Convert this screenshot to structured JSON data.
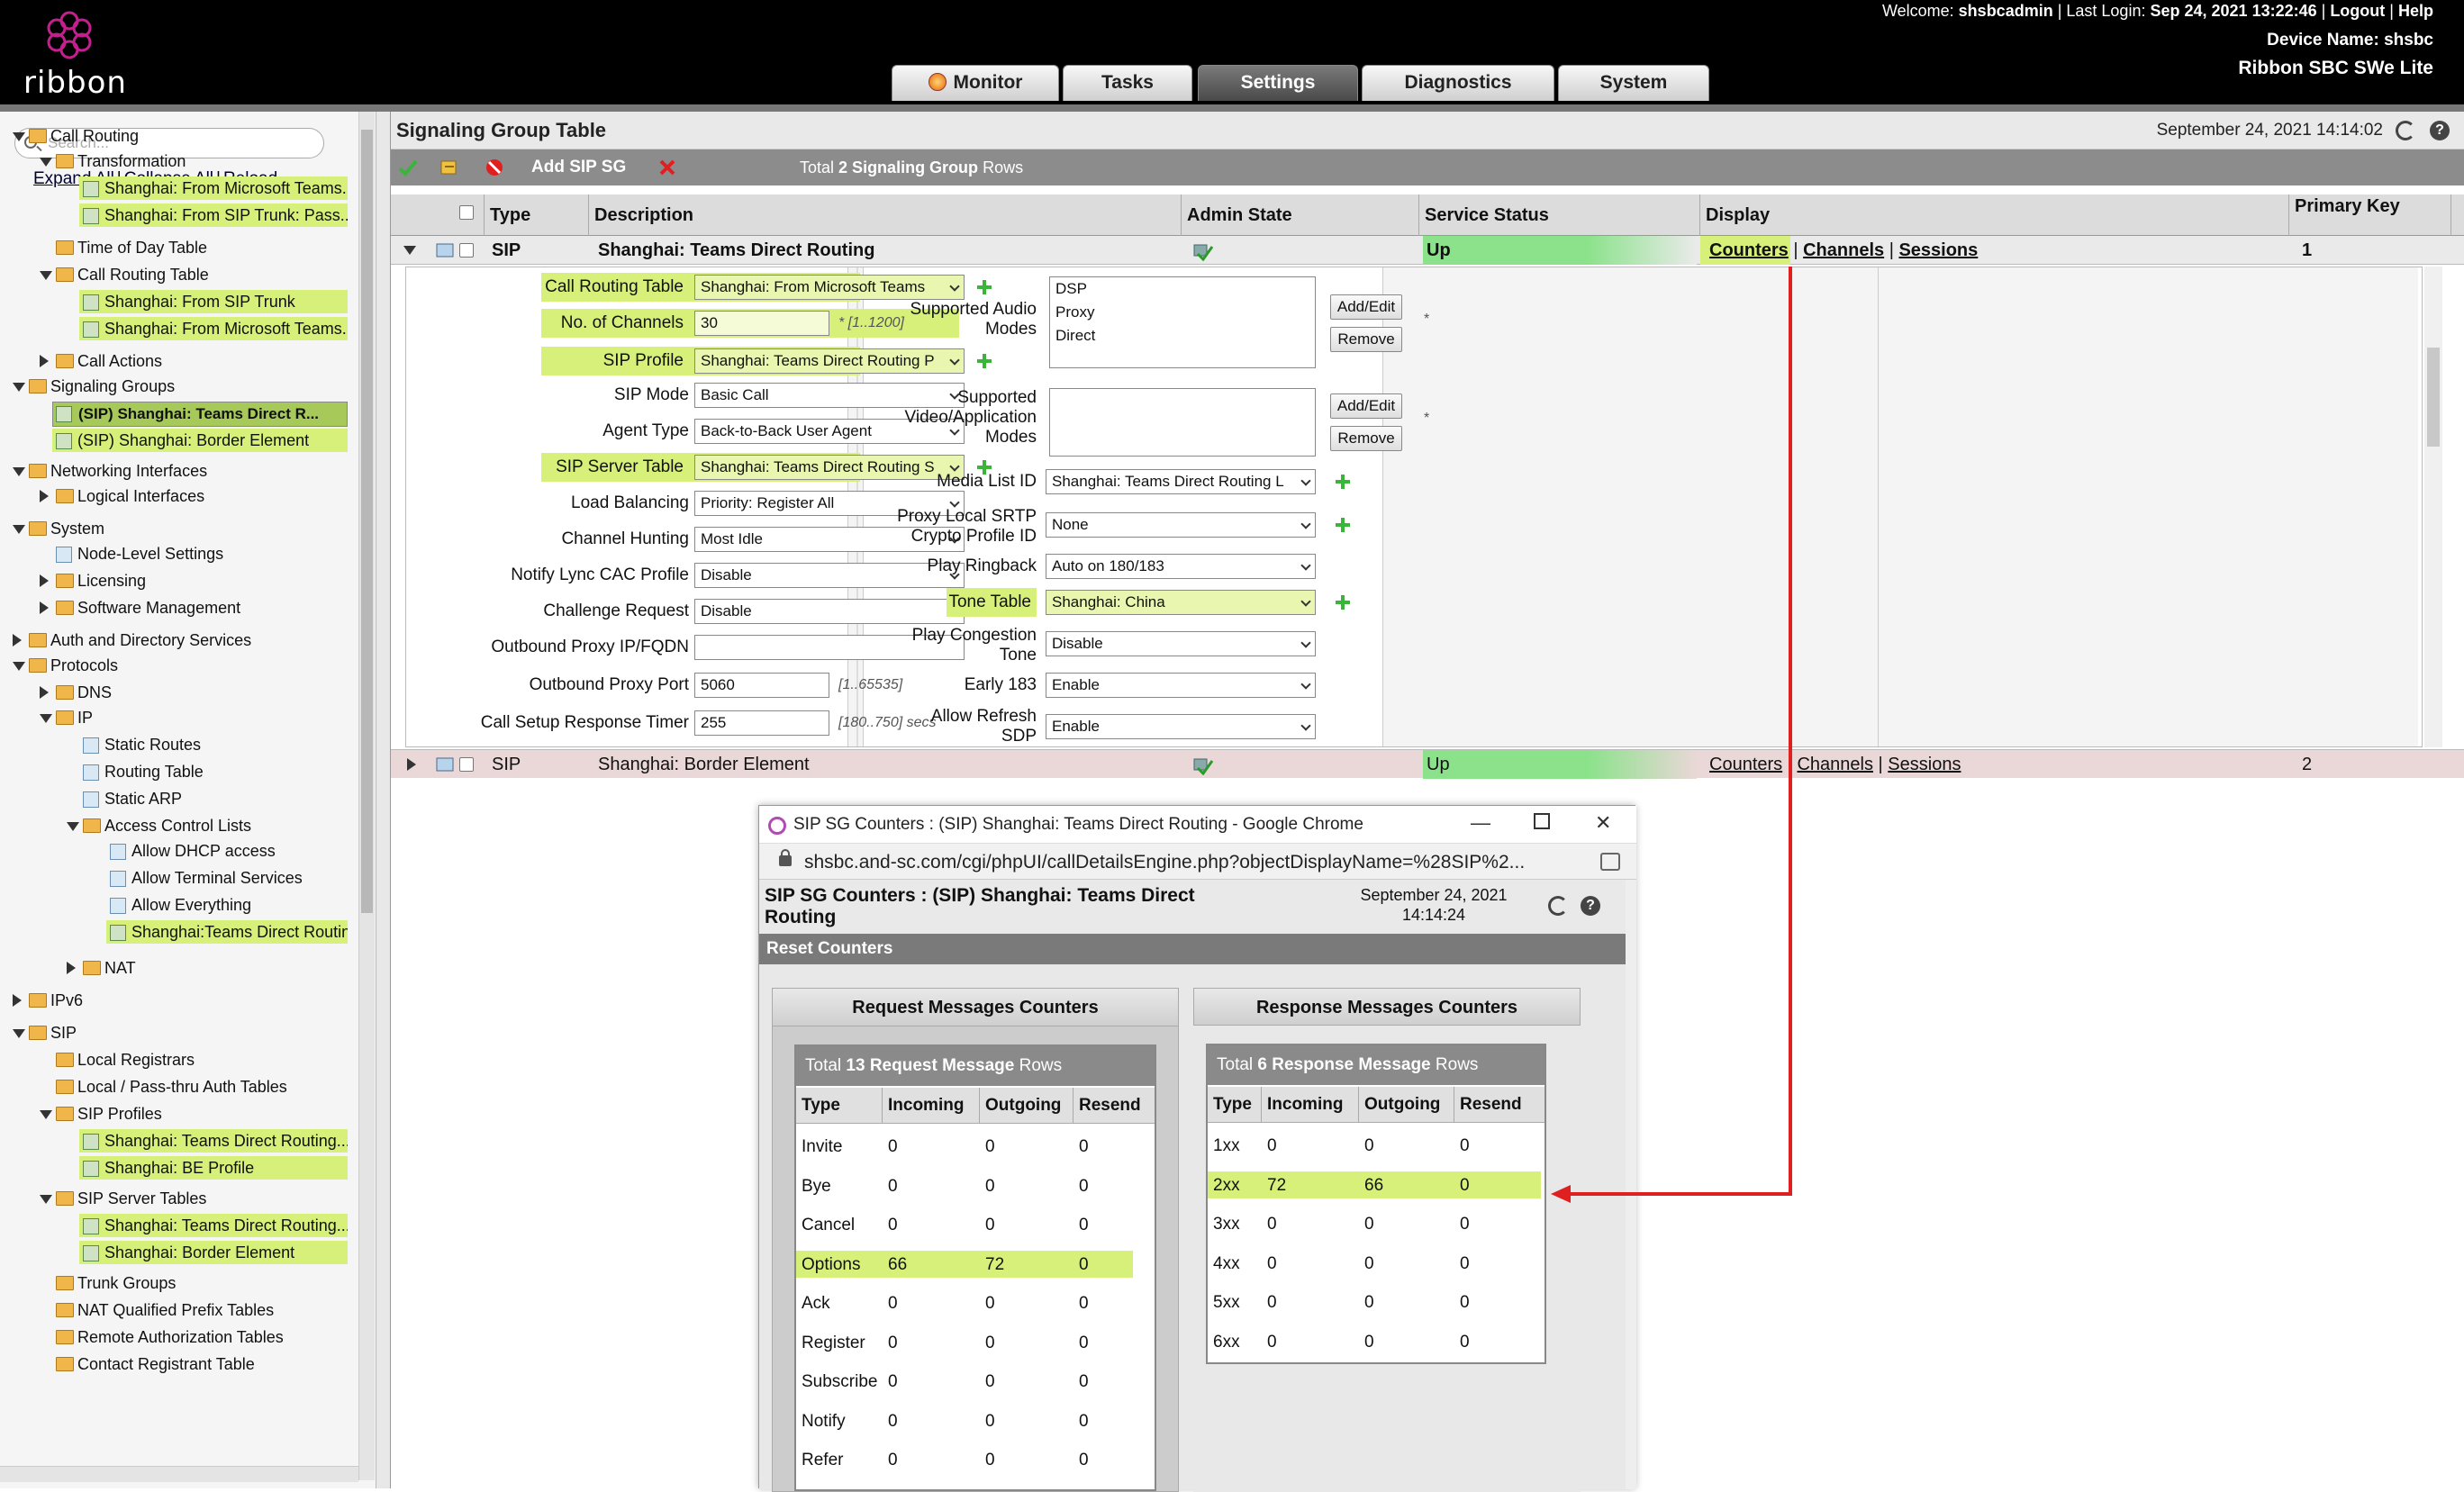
{
  "header": {
    "logo_text": "ribbon",
    "welcome_label": "Welcome:",
    "username": "shsbcadmin",
    "last_login_label": "Last Login:",
    "last_login": "Sep 24, 2021 13:22:46",
    "logout": "Logout",
    "help": "Help",
    "device_name": "Device Name: shsbc",
    "product": "Ribbon SBC SWe Lite",
    "tabs": [
      "Monitor",
      "Tasks",
      "Settings",
      "Diagnostics",
      "System"
    ],
    "active_tab": "Settings"
  },
  "sidebar": {
    "search_placeholder": "Search...",
    "expand_all": "Expand All",
    "collapse_all": "Collapse All",
    "reload": "Reload",
    "tree": [
      "Call Routing",
      "Transformation",
      "Shanghai: From Microsoft Teams...",
      "Shanghai: From SIP Trunk: Pass...",
      "Time of Day Table",
      "Call Routing Table",
      "Shanghai: From SIP Trunk",
      "Shanghai: From Microsoft Teams...",
      "Call Actions",
      "Signaling Groups",
      "(SIP) Shanghai: Teams Direct R...",
      "(SIP) Shanghai: Border Element",
      "Networking Interfaces",
      "Logical Interfaces",
      "System",
      "Node-Level Settings",
      "Licensing",
      "Software Management",
      "Auth and Directory Services",
      "Protocols",
      "DNS",
      "IP",
      "Static Routes",
      "Routing Table",
      "Static ARP",
      "Access Control Lists",
      "Allow DHCP access",
      "Allow Terminal Services",
      "Allow Everything",
      "Shanghai:Teams Direct Routin",
      "NAT",
      "IPv6",
      "SIP",
      "Local Registrars",
      "Local / Pass-thru Auth Tables",
      "SIP Profiles",
      "Shanghai: Teams Direct Routing...",
      "Shanghai: BE Profile",
      "SIP Server Tables",
      "Shanghai: Teams Direct Routing...",
      "Shanghai: Border Element",
      "Trunk Groups",
      "NAT Qualified Prefix Tables",
      "Remote Authorization Tables",
      "Contact Registrant Table"
    ]
  },
  "main": {
    "title": "Signaling Group Table",
    "datetime": "September 24, 2021 14:14:02",
    "add_sip_sg": "Add SIP SG",
    "total_prefix": "Total",
    "total_count": "2 Signaling Group",
    "total_suffix": "Rows",
    "columns": [
      "Type",
      "Description",
      "Admin State",
      "Service Status",
      "Display",
      "Primary Key"
    ],
    "rows": [
      {
        "type": "SIP",
        "description": "Shanghai: Teams Direct Routing",
        "status": "Up",
        "counters": "Counters",
        "channels": "Channels",
        "sessions": "Sessions",
        "key": "1"
      },
      {
        "type": "SIP",
        "description": "Shanghai: Border Element",
        "status": "Up",
        "counters": "Counters",
        "channels": "Channels",
        "sessions": "Sessions",
        "key": "2"
      }
    ],
    "form_left": [
      {
        "label": "Call Routing Table",
        "value": "Shanghai: From Microsoft Teams"
      },
      {
        "label": "No. of Channels",
        "value": "30",
        "hint": "* [1..1200]"
      },
      {
        "label": "SIP Profile",
        "value": "Shanghai: Teams Direct Routing P"
      },
      {
        "label": "SIP Mode",
        "value": "Basic Call"
      },
      {
        "label": "Agent Type",
        "value": "Back-to-Back User Agent"
      },
      {
        "label": "SIP Server Table",
        "value": "Shanghai: Teams Direct Routing S"
      },
      {
        "label": "Load Balancing",
        "value": "Priority: Register All"
      },
      {
        "label": "Channel Hunting",
        "value": "Most Idle"
      },
      {
        "label": "Notify Lync CAC Profile",
        "value": "Disable"
      },
      {
        "label": "Challenge Request",
        "value": "Disable"
      },
      {
        "label": "Outbound Proxy IP/FQDN",
        "value": ""
      },
      {
        "label": "Outbound Proxy Port",
        "value": "5060",
        "hint": "[1..65535]"
      },
      {
        "label": "Call Setup Response Timer",
        "value": "255",
        "hint": "[180..750] secs"
      }
    ],
    "form_right": {
      "audio_label_1": "Supported Audio",
      "audio_label_2": "Modes",
      "audio_modes": [
        "DSP",
        "Proxy",
        "Direct"
      ],
      "video_label_1": "Supported",
      "video_label_2": "Video/Application",
      "video_label_3": "Modes",
      "add_edit": "Add/Edit",
      "remove": "Remove",
      "asterisk": "*",
      "media_list_label": "Media List ID",
      "media_list_value": "Shanghai: Teams Direct Routing L",
      "srtp_label_1": "Proxy Local SRTP",
      "srtp_label_2": "Crypto Profile ID",
      "srtp_value": "None",
      "ringback_label": "Play Ringback",
      "ringback_value": "Auto on 180/183",
      "tone_label": "Tone Table",
      "tone_value": "Shanghai: China",
      "congestion_label_1": "Play Congestion",
      "congestion_label_2": "Tone",
      "congestion_value": "Disable",
      "early_label": "Early 183",
      "early_value": "Enable",
      "refresh_label_1": "Allow Refresh",
      "refresh_label_2": "SDP",
      "refresh_value": "Enable"
    }
  },
  "popup": {
    "window_title": "SIP SG Counters : (SIP) Shanghai: Teams Direct Routing - Google Chrome",
    "url": "shsbc.and-sc.com/cgi/phpUI/callDetailsEngine.php?objectDisplayName=%28SIP%2...",
    "title": "SIP SG Counters : (SIP) Shanghai: Teams Direct Routing",
    "date": "September 24, 2021",
    "time": "14:14:24",
    "reset": "Reset Counters",
    "request": {
      "panel": "Request Messages Counters",
      "total_prefix": "Total",
      "total": "13 Request Message",
      "total_suffix": "Rows",
      "cols": [
        "Type",
        "Incoming",
        "Outgoing",
        "Resend"
      ],
      "rows": [
        [
          "Invite",
          "0",
          "0",
          "0"
        ],
        [
          "Bye",
          "0",
          "0",
          "0"
        ],
        [
          "Cancel",
          "0",
          "0",
          "0"
        ],
        [
          "Options",
          "66",
          "72",
          "0"
        ],
        [
          "Ack",
          "0",
          "0",
          "0"
        ],
        [
          "Register",
          "0",
          "0",
          "0"
        ],
        [
          "Subscribe",
          "0",
          "0",
          "0"
        ],
        [
          "Notify",
          "0",
          "0",
          "0"
        ],
        [
          "Refer",
          "0",
          "0",
          "0"
        ]
      ]
    },
    "response": {
      "panel": "Response Messages Counters",
      "total_prefix": "Total",
      "total": "6 Response Message",
      "total_suffix": "Rows",
      "cols": [
        "Type",
        "Incoming",
        "Outgoing",
        "Resend"
      ],
      "rows": [
        [
          "1xx",
          "0",
          "0",
          "0"
        ],
        [
          "2xx",
          "72",
          "66",
          "0"
        ],
        [
          "3xx",
          "0",
          "0",
          "0"
        ],
        [
          "4xx",
          "0",
          "0",
          "0"
        ],
        [
          "5xx",
          "0",
          "0",
          "0"
        ],
        [
          "6xx",
          "0",
          "0",
          "0"
        ]
      ]
    }
  },
  "colors": {
    "highlight": "#d7f07a",
    "up_green": "#8be28b",
    "arrow_red": "#e02020",
    "black_header": "#000000"
  }
}
